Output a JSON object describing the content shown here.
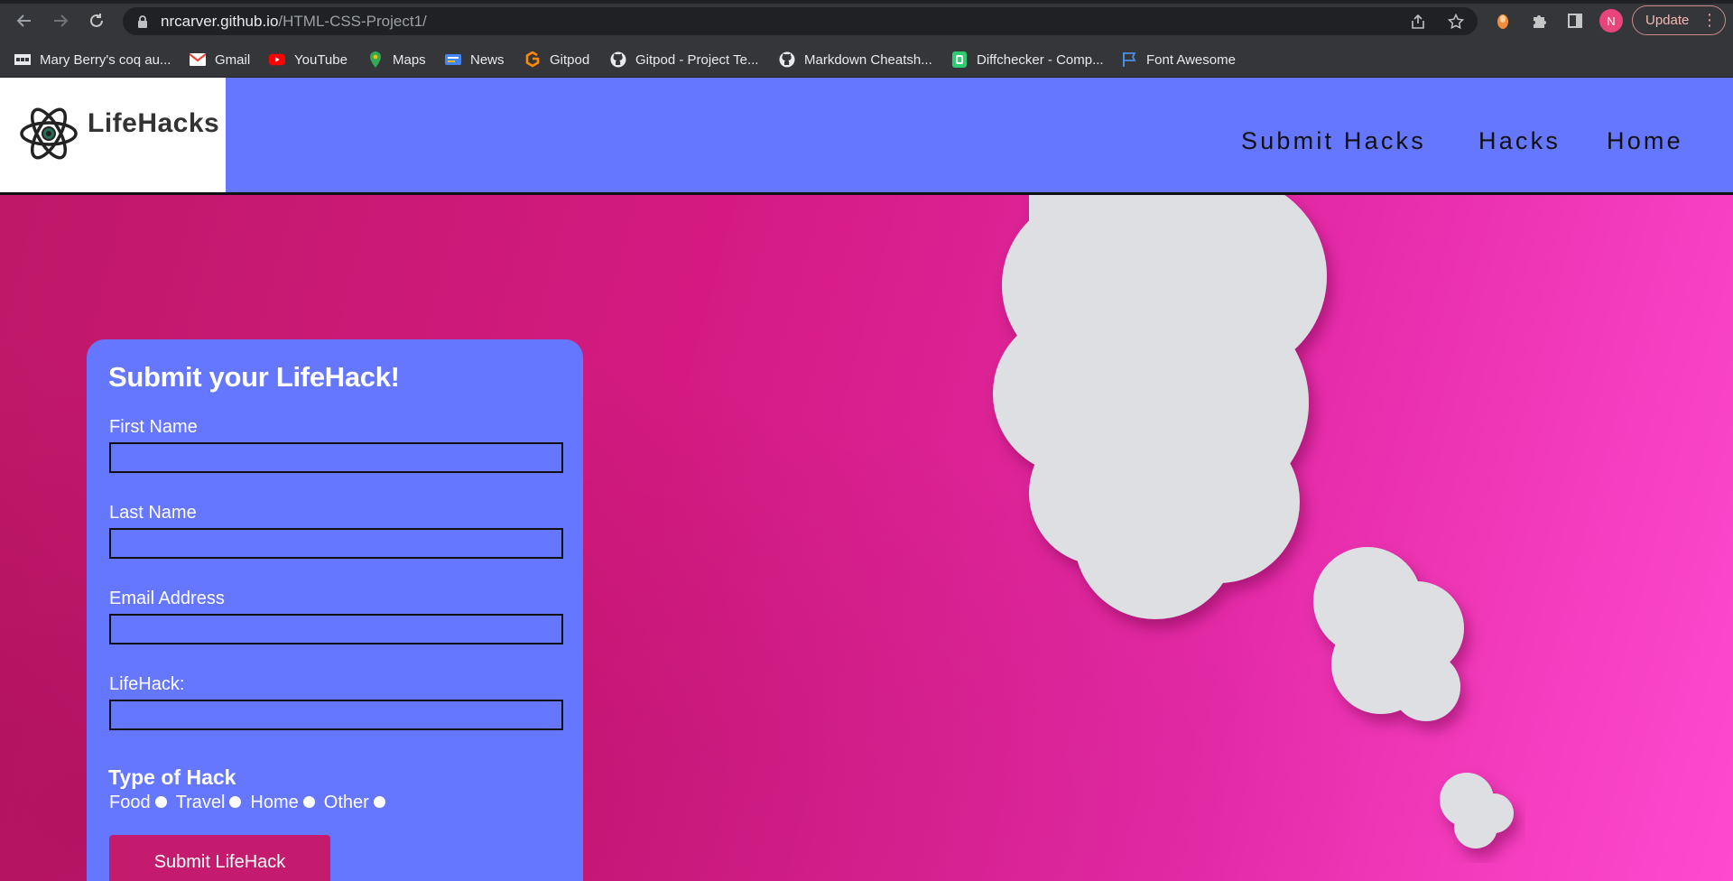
{
  "browser": {
    "url_host": "nrcarver.github.io",
    "url_path": "/HTML-CSS-Project1/",
    "update_label": "Update",
    "profile_initial": "N"
  },
  "bookmarks": [
    {
      "label": "Mary Berry's coq au...",
      "icon": "site-grid-icon",
      "color": "#e8eaed"
    },
    {
      "label": "Gmail",
      "icon": "gmail-icon",
      "color": "#ea4335"
    },
    {
      "label": "YouTube",
      "icon": "youtube-icon",
      "color": "#ff0000"
    },
    {
      "label": "Maps",
      "icon": "maps-icon",
      "color": "#34a853"
    },
    {
      "label": "News",
      "icon": "news-icon",
      "color": "#4285f4"
    },
    {
      "label": "Gitpod",
      "icon": "gitpod-icon",
      "color": "#ff8a00"
    },
    {
      "label": "Gitpod - Project Te...",
      "icon": "github-icon",
      "color": "#e8eaed"
    },
    {
      "label": "Markdown Cheatsh...",
      "icon": "github-icon",
      "color": "#e8eaed"
    },
    {
      "label": "Diffchecker - Comp...",
      "icon": "diffchecker-icon",
      "color": "#2ecc71"
    },
    {
      "label": "Font Awesome",
      "icon": "flag-icon",
      "color": "#4a90e2"
    }
  ],
  "site": {
    "logo_text": "LifeHacks",
    "nav": [
      "Submit Hacks",
      "Hacks",
      "Home"
    ]
  },
  "form": {
    "title": "Submit your LifeHack!",
    "fields": [
      {
        "label": "First Name",
        "value": ""
      },
      {
        "label": "Last Name",
        "value": ""
      },
      {
        "label": "Email Address",
        "value": ""
      },
      {
        "label": "LifeHack:",
        "value": ""
      }
    ],
    "type_title": "Type of Hack",
    "types": [
      "Food",
      "Travel",
      "Home",
      "Other"
    ],
    "submit_label": "Submit LifeHack"
  },
  "colors": {
    "header": "#6677ff",
    "hero": "#d41a82",
    "button": "#c41b6e"
  }
}
